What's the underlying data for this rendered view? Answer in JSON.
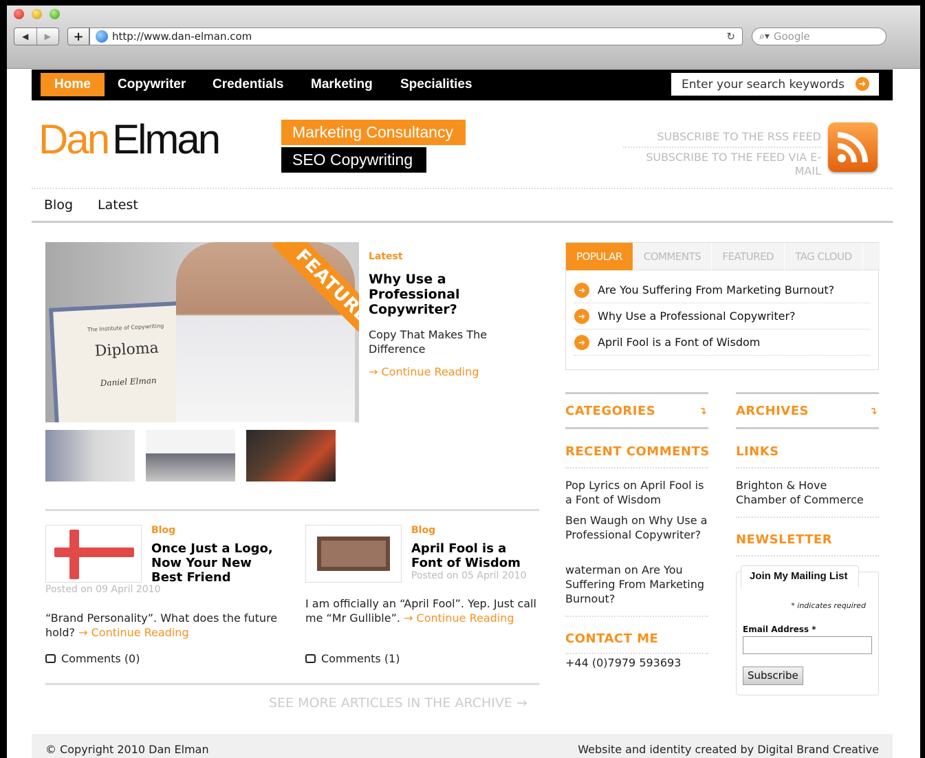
{
  "browser": {
    "url": "http://www.dan-elman.com",
    "search_placeholder": "Google"
  },
  "topnav": {
    "items": [
      "Home",
      "Copywriter",
      "Credentials",
      "Marketing",
      "Specialities"
    ],
    "search_placeholder": "Enter your search keywords"
  },
  "header": {
    "logo_first": "Dan",
    "logo_last": "Elman",
    "tagline1": "Marketing Consultancy",
    "tagline2": "SEO Copywriting",
    "rss1": "SUBSCRIBE TO THE RSS FEED",
    "rss2": "SUBSCRIBE TO THE FEED VIA E-MAIL"
  },
  "subnav": [
    "Blog",
    "Latest"
  ],
  "featured": {
    "ribbon": "FEATURED",
    "diploma_small": "The Institute of Copywriting",
    "diploma_title": "Diploma",
    "diploma_name": "Daniel Elman",
    "category": "Latest",
    "title": "Why Use a Professional Copywriter?",
    "subtitle": "Copy That Makes The Difference",
    "more": "→ Continue Reading"
  },
  "posts": [
    {
      "category": "Blog",
      "title": "Once Just a Logo, Now Your New Best Friend",
      "date": "Posted on 09 April 2010",
      "excerpt": "“Brand Personality”. What does the future hold?",
      "more": "→ Continue Reading",
      "comments": "Comments (0)"
    },
    {
      "category": "Blog",
      "title": "April Fool is a Font of Wisdom",
      "date": "Posted on 05 April 2010",
      "excerpt": "I am officially an “April Fool”. Yep. Just call me “Mr Gullible”.",
      "more": "→ Continue Reading",
      "comments": "Comments (1)"
    }
  ],
  "see_more": "SEE MORE ARTICLES IN THE ARCHIVE →",
  "tabs": {
    "labels": [
      "POPULAR",
      "COMMENTS",
      "FEATURED",
      "TAG CLOUD"
    ],
    "items": [
      "Are You Suffering From Marketing Burnout?",
      "Why Use a Professional Copywriter?",
      "April Fool is a Font of Wisdom"
    ]
  },
  "sidebar": {
    "categories": "CATEGORIES",
    "archives": "ARCHIVES",
    "recent_comments": "RECENT COMMENTS",
    "comments": [
      "Pop Lyrics on April Fool is a Font of Wisdom",
      "Ben Waugh on Why Use a Professional Copywriter?",
      "waterman on Are You Suffering From Marketing Burnout?"
    ],
    "contact": "CONTACT ME",
    "phone": "+44 (0)7979 593693",
    "links": "LINKS",
    "link1": "Brighton & Hove Chamber of Commerce",
    "newsletter": "NEWSLETTER",
    "mailing_tab": "Join My Mailing List",
    "required": "* indicates required",
    "email_label": "Email Address *",
    "subscribe": "Subscribe"
  },
  "footer": {
    "left": "© Copyright 2010 Dan Elman",
    "right": "Website and identity created by Digital Brand Creative"
  },
  "colors": {
    "accent": "#f7911e",
    "nav_bg": "#000000"
  }
}
